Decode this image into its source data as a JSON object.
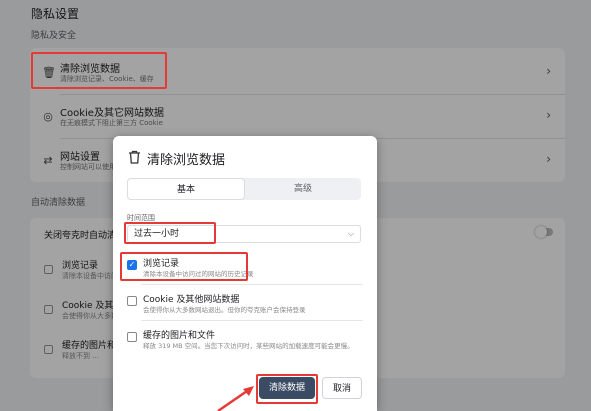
{
  "background": {
    "title": "隐私设置",
    "subtitle": "隐私及安全",
    "rows": [
      {
        "icon": "trash-icon",
        "title": "清除浏览数据",
        "sub": "清除浏览记录、Cookie、缓存"
      },
      {
        "icon": "cookie-icon",
        "title": "Cookie及其它网站数据",
        "sub": "在无痕模式下阻止第三方 Cookie"
      },
      {
        "icon": "sliders-icon",
        "title": "网站设置",
        "sub": "控制网站可以使用和显示什么信息"
      }
    ],
    "auto_clear_label": "自动清除数据",
    "auto_clear_toggle": "关闭夸克时自动清除",
    "auto_items": [
      {
        "title": "浏览记录",
        "sub": "清除本设备中访问..."
      },
      {
        "title": "Cookie 及其他",
        "sub": "会使得你从大多数..."
      },
      {
        "title": "缓存的图片和",
        "sub": "释放不到 ..."
      }
    ]
  },
  "dialog": {
    "title": "清除浏览数据",
    "tabs": [
      "基本",
      "高级"
    ],
    "active_tab": 0,
    "time_range_label": "时间范围",
    "time_range_value": "过去一小时",
    "items": [
      {
        "title": "浏览记录",
        "sub": "清除本设备中访问过的网站的历史记录",
        "checked": true
      },
      {
        "title": "Cookie 及其他网站数据",
        "sub": "会使得你从大多数网站退出。但你的夸克账户会保持登录",
        "checked": false
      },
      {
        "title": "缓存的图片和文件",
        "sub": "释放 319 MB 空间。当您下次访问时，某些网站的加载速度可能会更慢。",
        "checked": false
      }
    ],
    "clear_button": "清除数据",
    "cancel_button": "取消"
  },
  "colors": {
    "accent": "#1a73e8",
    "highlight": "#e53935",
    "primary_button": "#3c4b64"
  }
}
